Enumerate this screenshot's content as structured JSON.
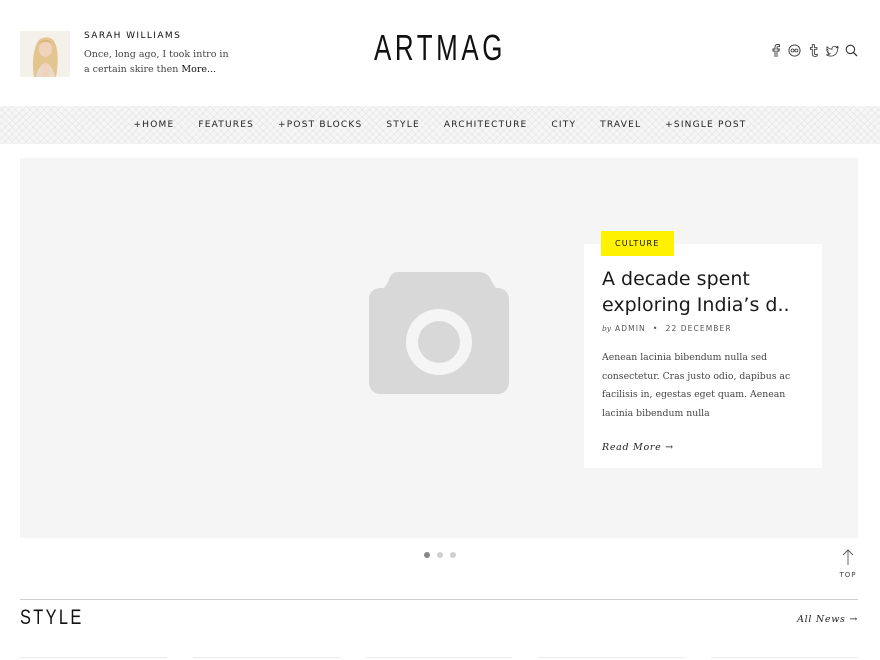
{
  "author": {
    "name": "SARAH WILLIAMS",
    "intro": "Once, long ago, I took intro in a certain skire then",
    "more_label": "More..."
  },
  "logo": "ARTMAG",
  "socials": [
    "facebook-icon",
    "flickr-icon",
    "tumblr-icon",
    "twitter-icon",
    "search-icon"
  ],
  "nav": {
    "items": [
      "+HOME",
      "FEATURES",
      "+POST BLOCKS",
      "STYLE",
      "ARCHITECTURE",
      "CITY",
      "TRAVEL",
      "+SINGLE POST"
    ]
  },
  "featured": {
    "category": "CULTURE",
    "title": "A decade spent exploring India’s d..",
    "by": "by",
    "author": "ADMIN",
    "date": "22 DECEMBER",
    "excerpt": "Aenean lacinia bibendum nulla sed consectetur. Cras justo odio, dapibus ac facilisis in, egestas eget quam. Aenean lacinia bibendum nulla",
    "read_more": "Read More →"
  },
  "slider": {
    "slides": 3,
    "active_index": 0
  },
  "top_label": "TOP",
  "section": {
    "title": "STYLE",
    "all_news": "All News →"
  },
  "colors": {
    "accent": "#fff200",
    "slider_bg": "#f5f5f5",
    "placeholder": "#d8d8d8"
  }
}
